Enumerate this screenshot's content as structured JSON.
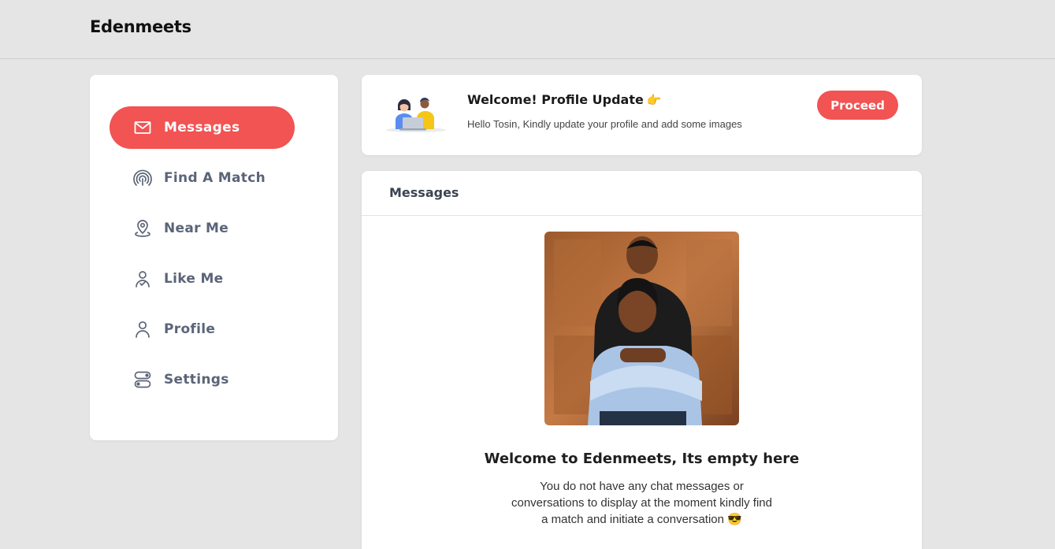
{
  "app": {
    "brand": "Edenmeets"
  },
  "sidebar": {
    "items": [
      {
        "label": "Messages",
        "icon": "mail-icon",
        "active": true
      },
      {
        "label": "Find A Match",
        "icon": "signal-icon",
        "active": false
      },
      {
        "label": "Near Me",
        "icon": "location-pin-icon",
        "active": false
      },
      {
        "label": "Like Me",
        "icon": "user-check-icon",
        "active": false
      },
      {
        "label": "Profile",
        "icon": "user-icon",
        "active": false
      },
      {
        "label": "Settings",
        "icon": "toggle-settings-icon",
        "active": false
      }
    ]
  },
  "welcome": {
    "title": "Welcome! Profile Update",
    "emoji": "👉",
    "subtitle": "Hello Tosin, Kindly update your profile and add some images",
    "button_label": "Proceed"
  },
  "messages": {
    "header": "Messages",
    "empty_title": "Welcome to Edenmeets, Its empty here",
    "empty_text": "You do not have any chat messages or conversations to display at the moment kindly find a match and initiate a conversation 😎"
  },
  "colors": {
    "accent": "#f25353",
    "nav_text": "#5b6478",
    "background": "#e5e5e5"
  }
}
